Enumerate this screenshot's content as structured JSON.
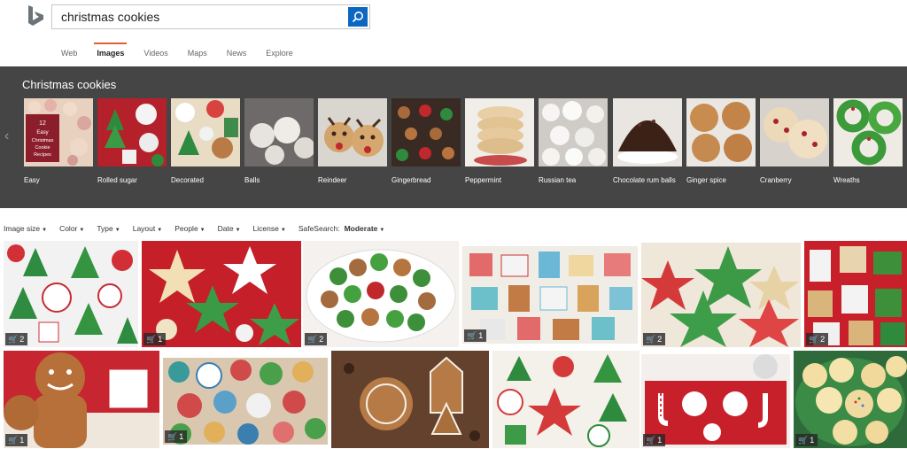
{
  "search": {
    "query": "christmas cookies",
    "button_icon": "search-icon"
  },
  "nav": {
    "tabs": [
      {
        "label": "Web"
      },
      {
        "label": "Images",
        "active": true
      },
      {
        "label": "Videos"
      },
      {
        "label": "Maps"
      },
      {
        "label": "News"
      },
      {
        "label": "Explore"
      }
    ]
  },
  "related": {
    "title": "Christmas cookies",
    "items": [
      {
        "label": "Easy"
      },
      {
        "label": "Rolled sugar"
      },
      {
        "label": "Decorated"
      },
      {
        "label": "Balls"
      },
      {
        "label": "Reindeer"
      },
      {
        "label": "Gingerbread"
      },
      {
        "label": "Peppermint"
      },
      {
        "label": "Russian tea"
      },
      {
        "label": "Chocolate rum balls"
      },
      {
        "label": "Ginger spice"
      },
      {
        "label": "Cranberry"
      },
      {
        "label": "Wreaths"
      }
    ],
    "thumb_inset_text": "12 Easy Christmas Cookie Recipes"
  },
  "filters": {
    "items": [
      "Image size",
      "Color",
      "Type",
      "Layout",
      "People",
      "Date",
      "License"
    ],
    "safesearch_label": "SafeSearch:",
    "safesearch_value": "Moderate"
  },
  "results": {
    "row1_counts": [
      "2",
      "1",
      "2",
      "1",
      "2",
      "2"
    ],
    "row2_counts": [
      "1",
      "1",
      "",
      "",
      "1",
      "1"
    ]
  },
  "colors": {
    "accent": "#e25d2f",
    "search_button": "#0c67c0",
    "band": "#454545"
  }
}
